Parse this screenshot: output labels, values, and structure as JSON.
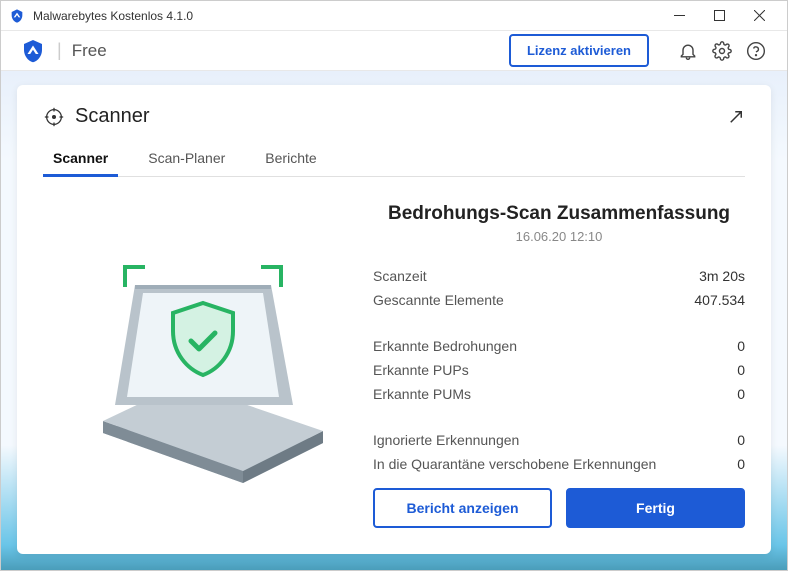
{
  "titlebar": {
    "text": "Malwarebytes Kostenlos  4.1.0"
  },
  "header": {
    "title": "Free",
    "license_button": "Lizenz aktivieren"
  },
  "card": {
    "title": "Scanner"
  },
  "tabs": [
    {
      "label": "Scanner",
      "active": true
    },
    {
      "label": "Scan-Planer",
      "active": false
    },
    {
      "label": "Berichte",
      "active": false
    }
  ],
  "summary": {
    "title": "Bedrohungs-Scan Zusammenfassung",
    "date": "16.06.20 12:10",
    "groups": [
      [
        {
          "label": "Scanzeit",
          "value": "3m 20s"
        },
        {
          "label": "Gescannte Elemente",
          "value": "407.534"
        }
      ],
      [
        {
          "label": "Erkannte Bedrohungen",
          "value": "0"
        },
        {
          "label": "Erkannte PUPs",
          "value": "0"
        },
        {
          "label": "Erkannte PUMs",
          "value": "0"
        }
      ],
      [
        {
          "label": "Ignorierte Erkennungen",
          "value": "0"
        },
        {
          "label": "In die Quarantäne verschobene Erkennungen",
          "value": "0"
        }
      ]
    ]
  },
  "buttons": {
    "report": "Bericht anzeigen",
    "done": "Fertig"
  }
}
